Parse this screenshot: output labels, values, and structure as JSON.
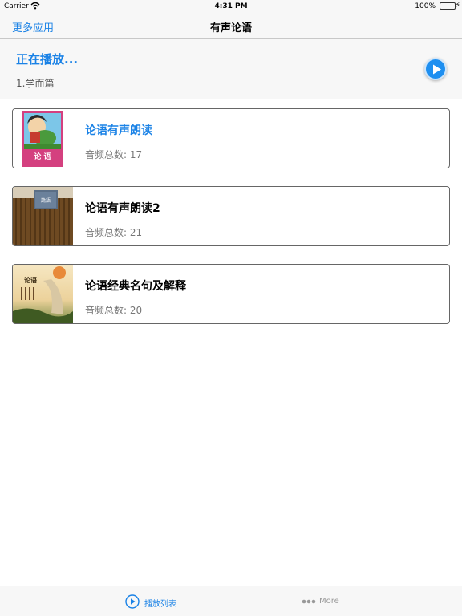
{
  "status_bar": {
    "carrier": "Carrier",
    "time": "4:31 PM",
    "battery": "100%"
  },
  "nav": {
    "left_label": "更多应用",
    "title": "有声论语"
  },
  "now_playing": {
    "title": "正在播放...",
    "track": "1.学而篇"
  },
  "albums": [
    {
      "title": "论语有声朗读",
      "count": "音频总数: 17",
      "active": true
    },
    {
      "title": "论语有声朗读2",
      "count": "音频总数: 21",
      "active": false
    },
    {
      "title": "论语经典名句及解释",
      "count": "音频总数: 20",
      "active": false
    }
  ],
  "tabs": {
    "playlist_label": "播放列表",
    "more_label": "More"
  },
  "thumb_texts": {
    "book1": "论 语",
    "book2": "論語",
    "book3": "论语"
  },
  "colors": {
    "accent": "#1a82e6",
    "bar_bg": "#f7f7f7"
  }
}
